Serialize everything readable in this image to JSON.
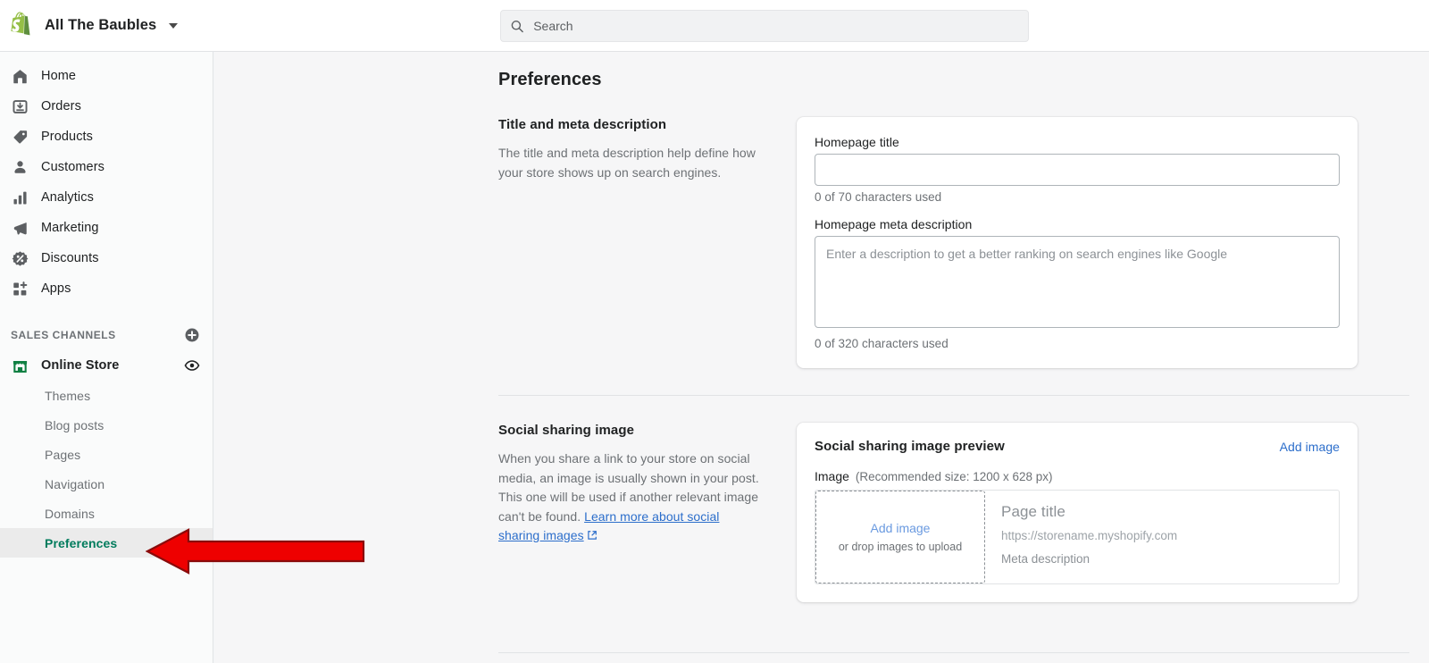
{
  "topbar": {
    "store_name": "All The Baubles",
    "logo_icon": "shopify-bag-icon",
    "caret_icon": "chevron-down-icon",
    "search_icon": "search-icon",
    "search_placeholder": "Search",
    "search_value": ""
  },
  "sidebar": {
    "nav": [
      {
        "label": "Home",
        "icon": "home-icon"
      },
      {
        "label": "Orders",
        "icon": "orders-inbox-icon"
      },
      {
        "label": "Products",
        "icon": "product-tag-icon"
      },
      {
        "label": "Customers",
        "icon": "customer-person-icon"
      },
      {
        "label": "Analytics",
        "icon": "analytics-bars-icon"
      },
      {
        "label": "Marketing",
        "icon": "marketing-megaphone-icon"
      },
      {
        "label": "Discounts",
        "icon": "discount-badge-icon"
      },
      {
        "label": "Apps",
        "icon": "apps-grid-plus-icon"
      }
    ],
    "sales_channels": {
      "title": "SALES CHANNELS",
      "add_icon": "plus-circle-icon",
      "channel": {
        "label": "Online Store",
        "icon": "storefront-icon",
        "view_icon": "eye-icon"
      },
      "sub_items": [
        {
          "label": "Themes",
          "active": false
        },
        {
          "label": "Blog posts",
          "active": false
        },
        {
          "label": "Pages",
          "active": false
        },
        {
          "label": "Navigation",
          "active": false
        },
        {
          "label": "Domains",
          "active": false
        },
        {
          "label": "Preferences",
          "active": true
        }
      ]
    }
  },
  "main": {
    "page_title": "Preferences",
    "title_meta_section": {
      "heading": "Title and meta description",
      "description": "The title and meta description help define how your store shows up on search engines.",
      "homepage_title_label": "Homepage title",
      "homepage_title_value": "",
      "homepage_title_counter": "0 of 70 characters used",
      "meta_description_label": "Homepage meta description",
      "meta_description_value": "",
      "meta_description_placeholder": "Enter a description to get a better ranking on search engines like Google",
      "meta_description_counter": "0 of 320 characters used"
    },
    "social_section": {
      "heading": "Social sharing image",
      "description_part1": "When you share a link to your store on social media, an image is usually shown in your post. This one will be used if another relevant image can't be found. ",
      "link_text": "Learn more about social sharing images",
      "link_icon": "external-link-icon",
      "preview_card": {
        "title": "Social sharing image preview",
        "action_label": "Add image",
        "image_label": "Image",
        "image_hint": "(Recommended size: 1200 x 628 px)",
        "dropzone_link": "Add image",
        "dropzone_sub": "or drop images to upload",
        "preview_title": "Page title",
        "preview_url": "https://storename.myshopify.com",
        "preview_description": "Meta description"
      }
    }
  },
  "annotation": {
    "arrow_icon": "left-arrow-annotation",
    "fill_color": "#ee0000",
    "stroke_color": "#8a0b0b",
    "direction": "left",
    "points_at": "Preferences"
  },
  "colors": {
    "accent_green": "#007b5c",
    "link_blue": "#2c6ecb",
    "brand_green": "#95bf47",
    "text_primary": "#202223",
    "text_subdued": "#6d7175"
  }
}
